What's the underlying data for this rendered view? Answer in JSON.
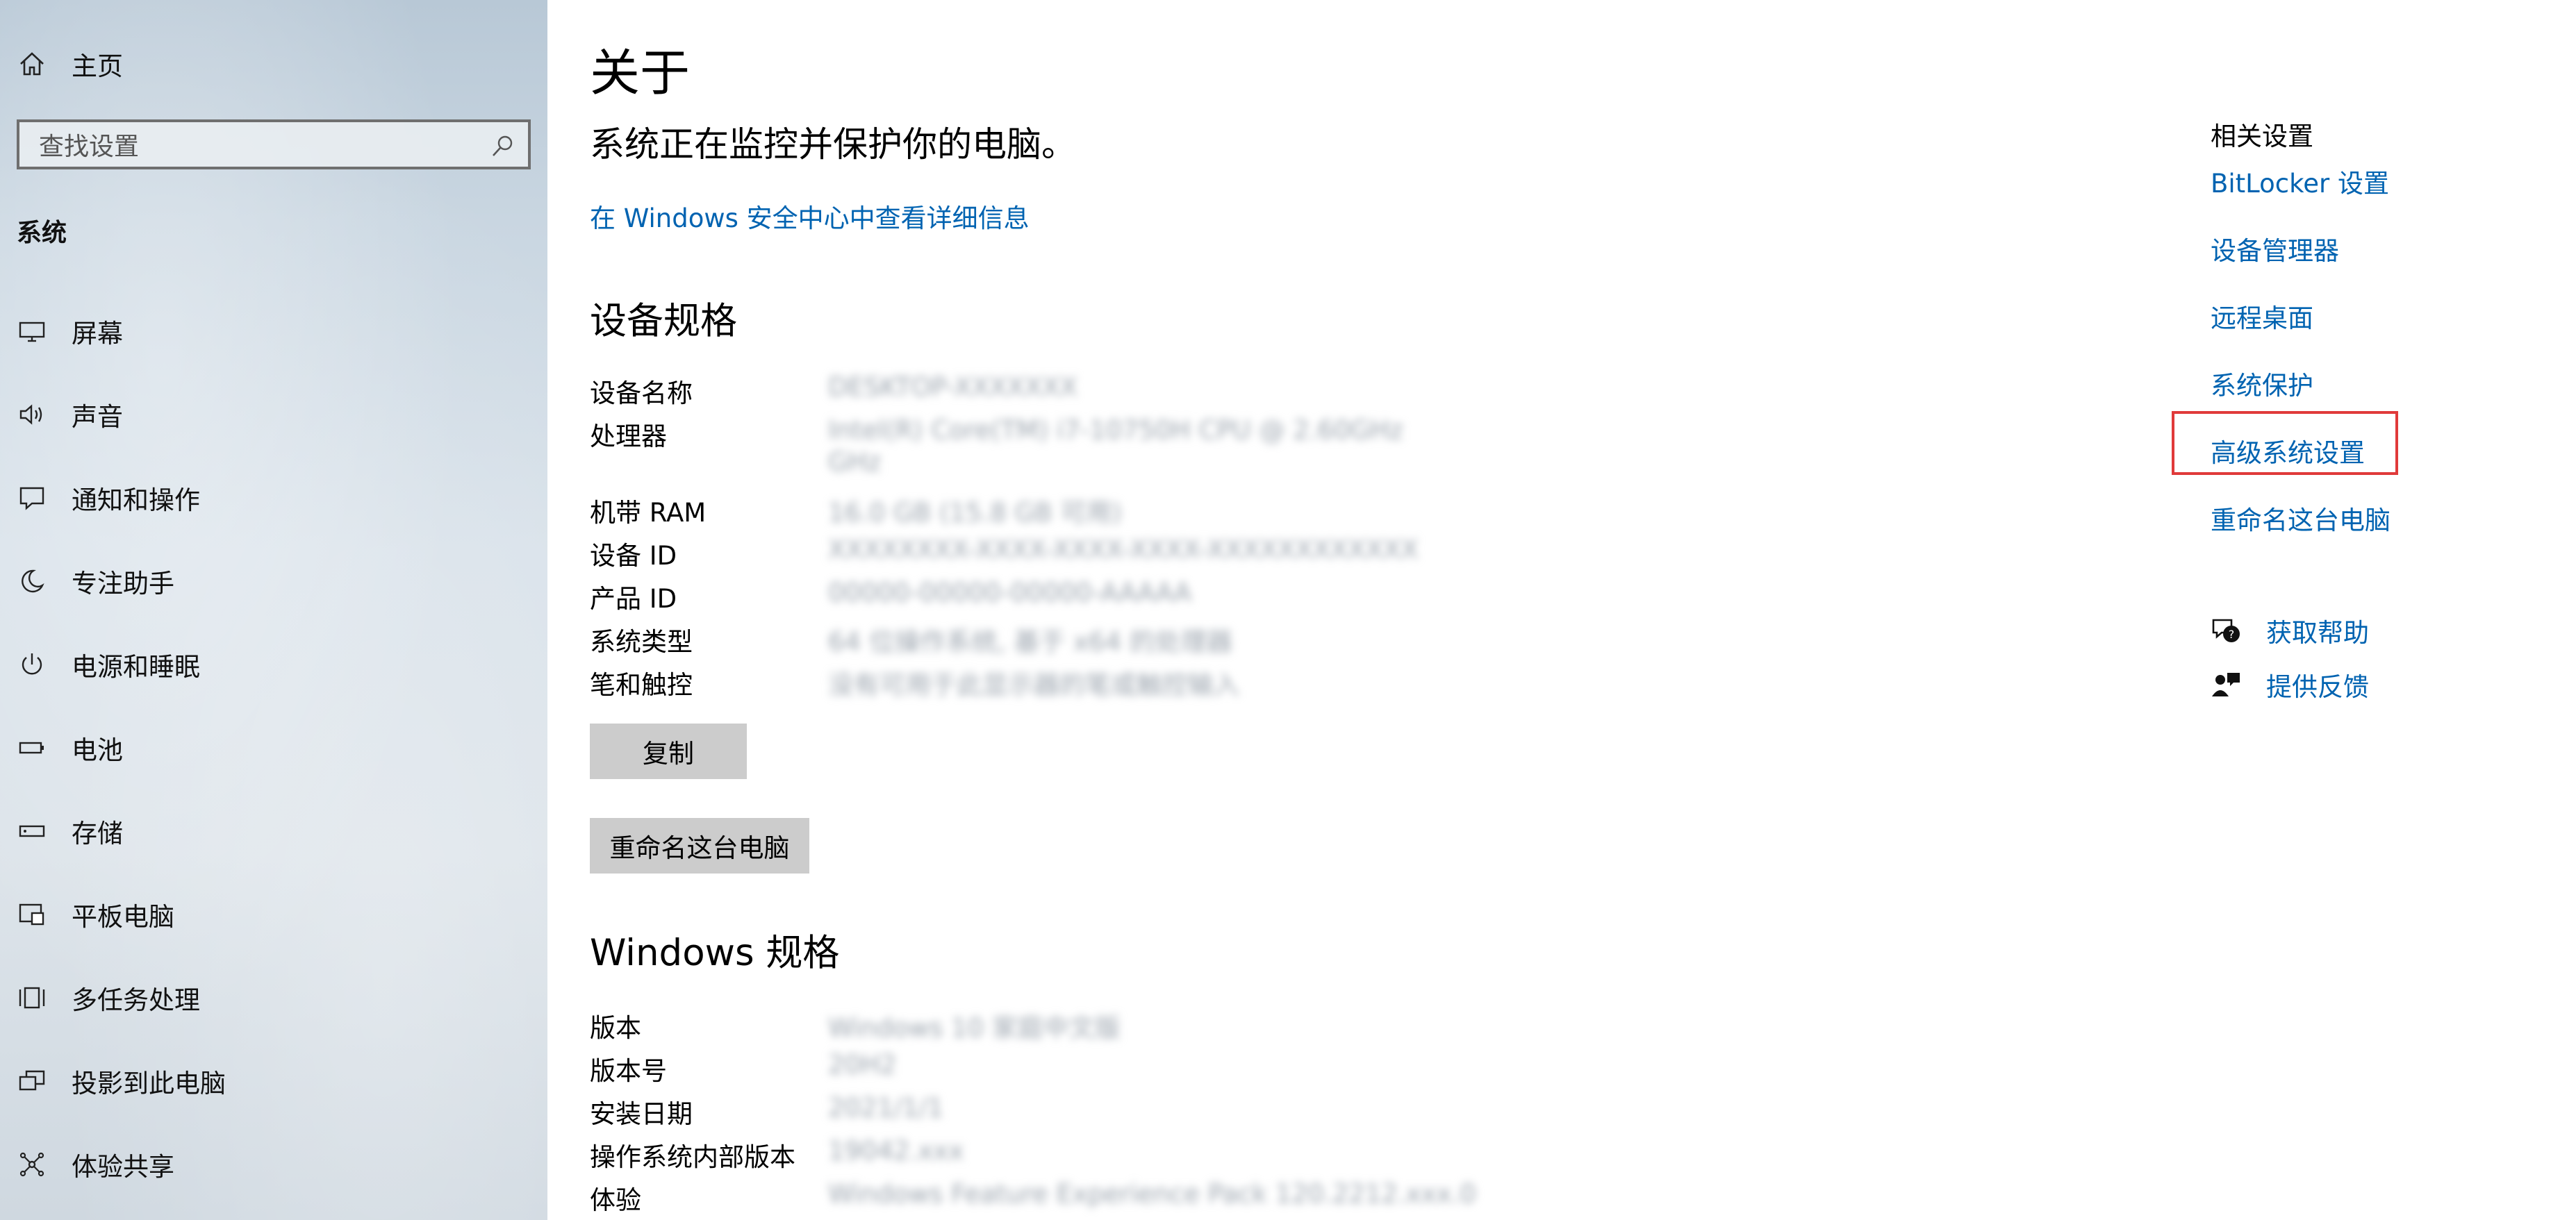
{
  "sidebar": {
    "home_label": "主页",
    "search_placeholder": "查找设置",
    "section_title": "系统",
    "items": [
      {
        "label": "屏幕",
        "icon": "display-icon"
      },
      {
        "label": "声音",
        "icon": "speaker-icon"
      },
      {
        "label": "通知和操作",
        "icon": "notification-icon"
      },
      {
        "label": "专注助手",
        "icon": "moon-icon"
      },
      {
        "label": "电源和睡眠",
        "icon": "power-icon"
      },
      {
        "label": "电池",
        "icon": "battery-icon"
      },
      {
        "label": "存储",
        "icon": "storage-icon"
      },
      {
        "label": "平板电脑",
        "icon": "tablet-icon"
      },
      {
        "label": "多任务处理",
        "icon": "multitask-icon"
      },
      {
        "label": "投影到此电脑",
        "icon": "project-icon"
      },
      {
        "label": "体验共享",
        "icon": "share-icon"
      }
    ]
  },
  "main": {
    "title": "关于",
    "status": "系统正在监控并保护你的电脑。",
    "security_link": "在 Windows 安全中心中查看详细信息",
    "device_specs": {
      "heading": "设备规格",
      "rows": [
        {
          "label": "设备名称",
          "value": "DESKTOP-XXXXXXX"
        },
        {
          "label": "处理器",
          "value": "Intel(R) Core(TM) i7-10750H CPU @ 2.60GHz",
          "value2": "GHz"
        },
        {
          "label": "机带 RAM",
          "value": "16.0 GB (15.8 GB 可用)"
        },
        {
          "label": "设备 ID",
          "value": "XXXXXXXX-XXXX-XXXX-XXXX-XXXXXXXXXXXX"
        },
        {
          "label": "产品 ID",
          "value": "00000-00000-00000-AAAAA"
        },
        {
          "label": "系统类型",
          "value": "64 位操作系统, 基于 x64 的处理器"
        },
        {
          "label": "笔和触控",
          "value": "没有可用于此显示器的笔或触控输入"
        }
      ],
      "copy_button": "复制",
      "rename_button": "重命名这台电脑"
    },
    "windows_specs": {
      "heading": "Windows 规格",
      "rows": [
        {
          "label": "版本",
          "value": "Windows 10 家庭中文版"
        },
        {
          "label": "版本号",
          "value": "20H2"
        },
        {
          "label": "安装日期",
          "value": "2021/1/1"
        },
        {
          "label": "操作系统内部版本",
          "value": "19042.xxx"
        },
        {
          "label": "体验",
          "value": "Windows Feature Experience Pack 120.2212.xxx.0"
        }
      ]
    }
  },
  "related": {
    "title": "相关设置",
    "links": [
      "BitLocker 设置",
      "设备管理器",
      "远程桌面",
      "系统保护",
      "高级系统设置",
      "重命名这台电脑"
    ],
    "highlighted": "高级系统设置",
    "highlight_color": "#e03a3a",
    "help": [
      {
        "label": "获取帮助",
        "icon": "help-chat-icon"
      },
      {
        "label": "提供反馈",
        "icon": "feedback-icon"
      }
    ]
  },
  "colors": {
    "link": "#0063b1",
    "button_bg": "#cccccc"
  }
}
